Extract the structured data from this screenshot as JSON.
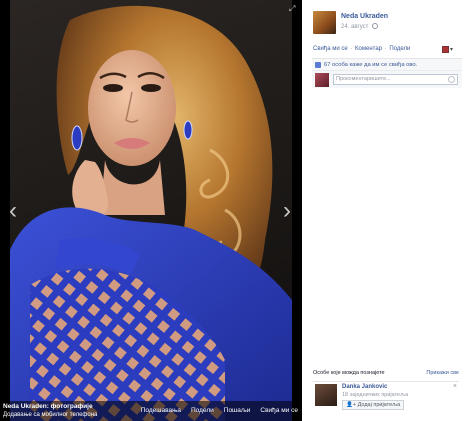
{
  "viewer": {
    "caption_title": "Neda Ukraden: фотографије",
    "caption_subtitle": "Додавање са мобилног телефона",
    "actions": [
      "Подешавања",
      "Подели",
      "Пошаљи",
      "Свиђа ми се"
    ],
    "expand_icon": "expand-icon",
    "prev_icon": "chevron-left-icon",
    "next_icon": "chevron-right-icon"
  },
  "post": {
    "author": "Neda Ukraden",
    "date": "24. август",
    "actions": [
      "Свиђа ми се",
      "Коментар",
      "Подели"
    ],
    "likes_text": "67 особа каже да им се свиђа ово.",
    "comment_placeholder": "Прокоментаришите..."
  },
  "pymk": {
    "title": "Особе које можда познајете",
    "see_all": "Прикажи све",
    "person": {
      "name": "Danka Jankovic",
      "mutual": "18 заједничких пријатеља",
      "add_label": "Додај пријатеља"
    }
  },
  "colors": {
    "link": "#3b5998",
    "dress": "#2d3fbf",
    "hair": "#b07a3a"
  }
}
